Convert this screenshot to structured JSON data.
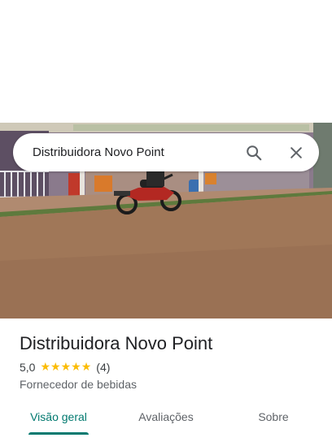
{
  "search": {
    "query": "Distribuidora Novo Point"
  },
  "icons": {
    "search": "search-icon",
    "close": "close-icon",
    "star": "star-icon"
  },
  "place": {
    "name": "Distribuidora Novo Point",
    "rating": "5,0",
    "stars": 5,
    "review_count": "(4)",
    "category": "Fornecedor de bebidas"
  },
  "tabs": [
    {
      "label": "Visão geral",
      "active": true
    },
    {
      "label": "Avaliações",
      "active": false
    },
    {
      "label": "Sobre",
      "active": false
    }
  ],
  "colors": {
    "accent": "#01796f",
    "star": "#fbbc04",
    "text_primary": "#202124",
    "text_secondary": "#5f6368"
  }
}
